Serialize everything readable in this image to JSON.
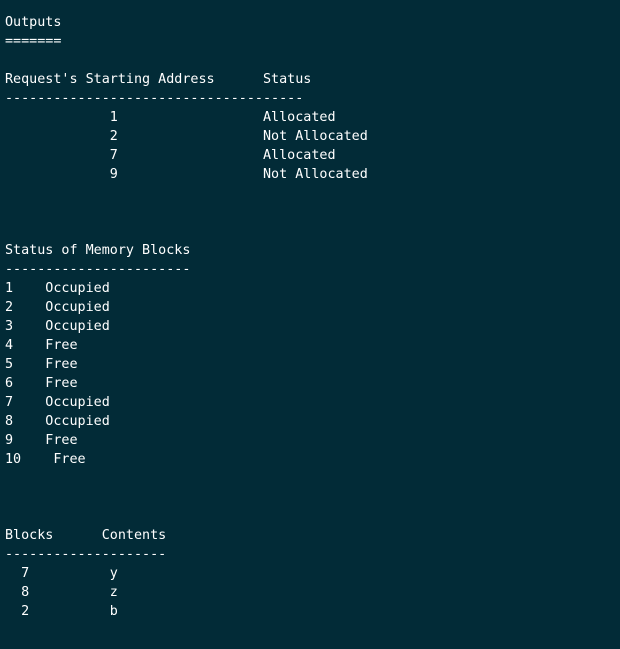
{
  "terminal": {
    "lines": [
      "Outputs",
      "=======",
      "",
      "Request's Starting Address      Status",
      "-------------------------------------",
      "             1                  Allocated",
      "             2                  Not Allocated",
      "             7                  Allocated",
      "             9                  Not Allocated",
      "",
      "",
      "",
      "Status of Memory Blocks",
      "-----------------------",
      "1    Occupied",
      "2    Occupied",
      "3    Occupied",
      "4    Free",
      "5    Free",
      "6    Free",
      "7    Occupied",
      "8    Occupied",
      "9    Free",
      "10    Free",
      "",
      "",
      "",
      "Blocks      Contents",
      "--------------------",
      "  7          y",
      "  8          z",
      "  2          b"
    ]
  }
}
